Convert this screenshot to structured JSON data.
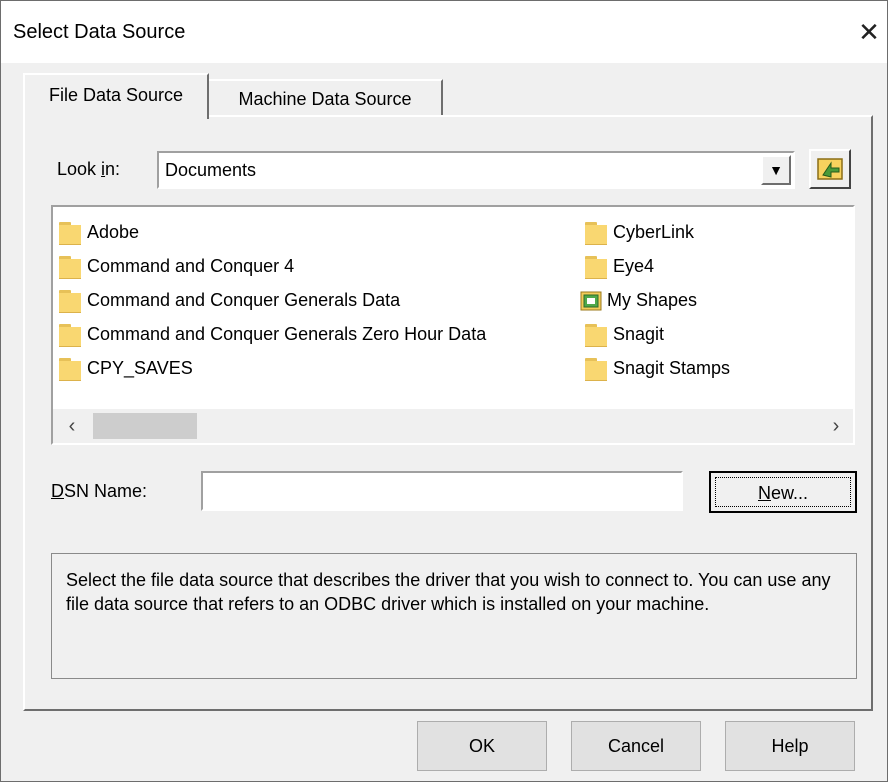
{
  "window": {
    "title": "Select Data Source",
    "close_glyph": "✕"
  },
  "tabs": [
    {
      "label": "File Data Source",
      "active": true
    },
    {
      "label": "Machine Data Source",
      "active": false
    }
  ],
  "look_in": {
    "label_before": "Look ",
    "label_accel": "i",
    "label_after": "n:",
    "value": "Documents",
    "dropdown_icon": "down-arrow-icon",
    "updir_icon": "up-folder-icon"
  },
  "files": {
    "left": [
      "Adobe",
      "Command and Conquer 4",
      "Command and Conquer Generals Data",
      "Command and Conquer Generals Zero Hour Data",
      "CPY_SAVES"
    ],
    "right": [
      "CyberLink",
      "Eye4",
      "My Shapes",
      "Snagit",
      "Snagit Stamps"
    ]
  },
  "scrollbar": {
    "left_arrow": "‹",
    "right_arrow": "›"
  },
  "dsn": {
    "label_accel": "D",
    "label_rest": "SN Name:",
    "value": ""
  },
  "new_button": {
    "accel": "N",
    "rest": "ew..."
  },
  "description": "Select the file data source that describes the driver that you wish to connect to. You can use any file data source that refers to an ODBC driver which is installed on your machine.",
  "buttons": {
    "ok": "OK",
    "cancel": "Cancel",
    "help": "Help"
  },
  "colors": {
    "folder": "#f9d771",
    "dialog_bg": "#f0f0f0",
    "button_bg": "#e1e1e1"
  }
}
